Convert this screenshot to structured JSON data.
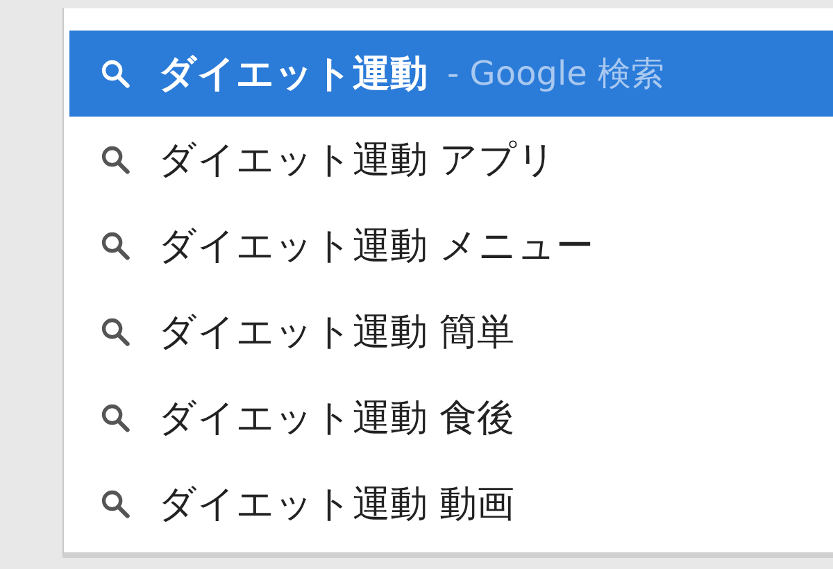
{
  "suggestions": [
    {
      "text": "ダイエット運動",
      "hint": "- Google 検索",
      "selected": true
    },
    {
      "text": "ダイエット運動 アプリ",
      "selected": false
    },
    {
      "text": "ダイエット運動 メニュー",
      "selected": false
    },
    {
      "text": "ダイエット運動 簡単",
      "selected": false
    },
    {
      "text": "ダイエット運動 食後",
      "selected": false
    },
    {
      "text": "ダイエット運動 動画",
      "selected": false
    }
  ]
}
